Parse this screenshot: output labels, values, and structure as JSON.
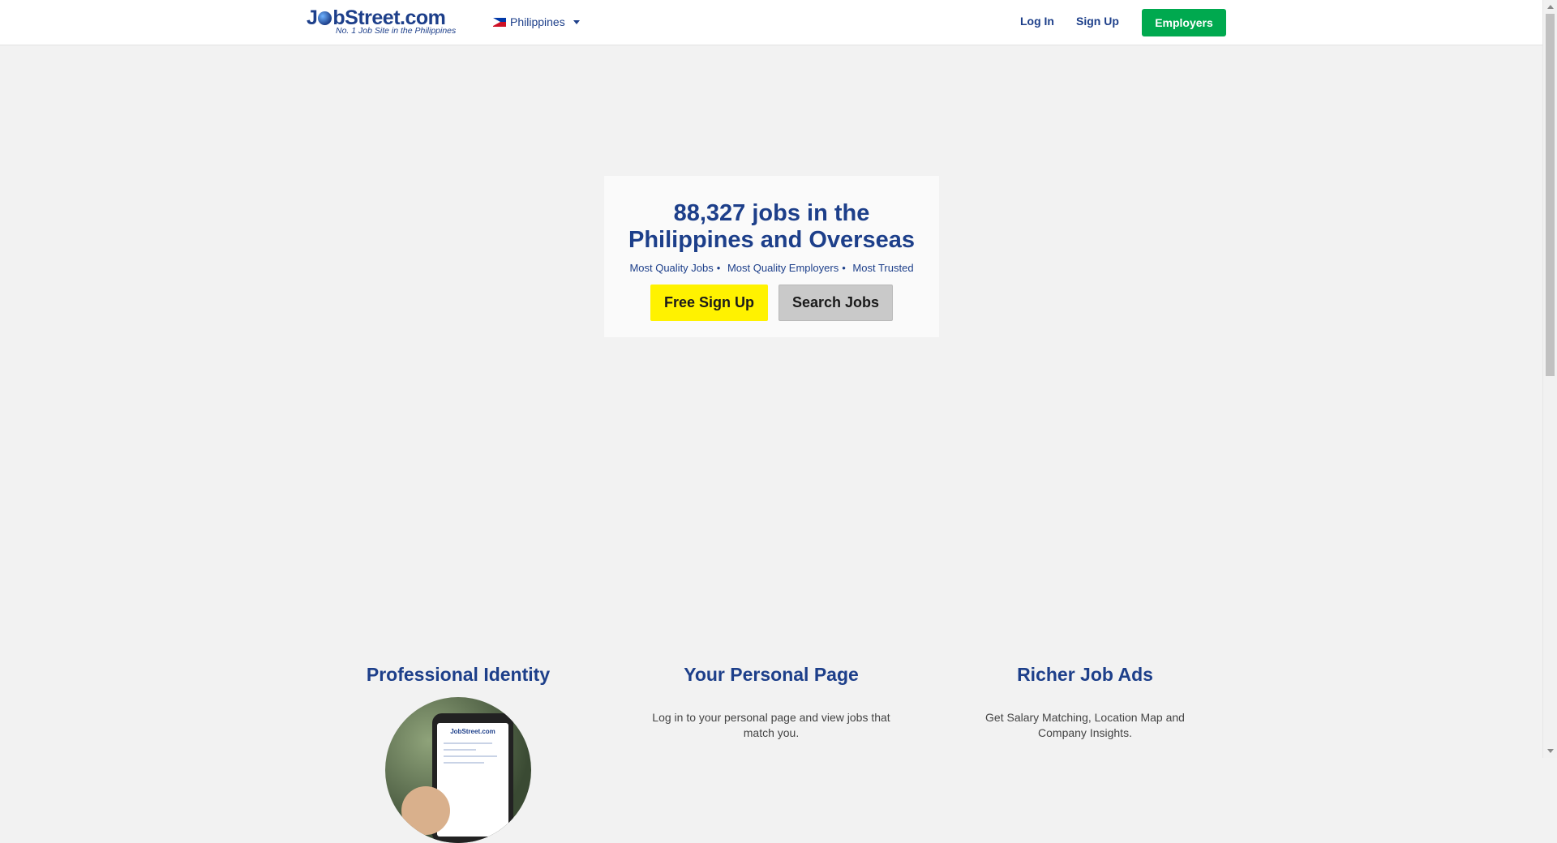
{
  "header": {
    "logo_text_pre": "J",
    "logo_text_post": "bStreet.com",
    "logo_tagline": "No. 1 Job Site in the Philippines",
    "country": "Philippines",
    "login_label": "Log In",
    "signup_label": "Sign Up",
    "employers_label": "Employers"
  },
  "hero": {
    "title_line1": "88,327 jobs in the",
    "title_line2": "Philippines and Overseas",
    "taglines": [
      "Most Quality Jobs",
      "Most Quality Employers",
      "Most Trusted"
    ],
    "separator": "•",
    "signup_button": "Free Sign Up",
    "search_button": "Search Jobs"
  },
  "features": [
    {
      "title": "Professional Identity",
      "description": ""
    },
    {
      "title": "Your Personal Page",
      "description": "Log in to your personal page and view jobs that match you."
    },
    {
      "title": "Richer Job Ads",
      "description": "Get Salary Matching, Location Map and Company Insights."
    }
  ],
  "colors": {
    "brand_blue": "#1d3f8a",
    "employers_green": "#00a94f",
    "signup_yellow": "#fff200",
    "search_gray": "#c9c9c9",
    "page_bg": "#f2f2f2"
  },
  "icons": {
    "country_flag": "philippines-flag-icon",
    "country_caret": "caret-down-icon"
  },
  "phone_logo": "JobStreet.com"
}
